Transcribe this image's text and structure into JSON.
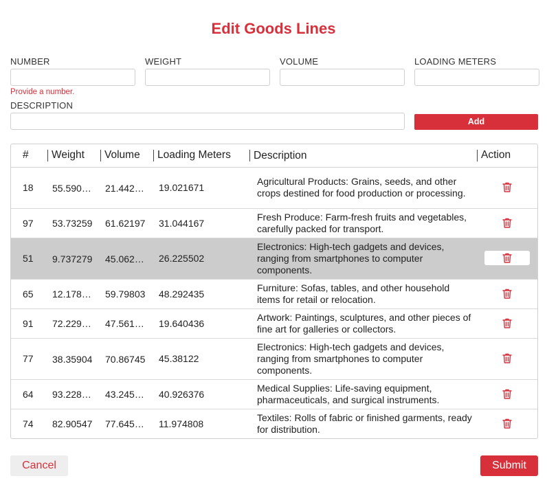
{
  "dialog": {
    "title": "Edit Goods Lines",
    "fields": {
      "number": {
        "label": "NUMBER",
        "value": ""
      },
      "weight": {
        "label": "WEIGHT",
        "value": ""
      },
      "volume": {
        "label": "VOLUME",
        "value": ""
      },
      "loading_meters": {
        "label": "LOADING METERS",
        "value": ""
      },
      "description": {
        "label": "DESCRIPTION",
        "value": ""
      }
    },
    "error_text": "Provide a number.",
    "add_label": "Add",
    "cancel_label": "Cancel",
    "submit_label": "Submit",
    "accent_color": "#d7303b"
  },
  "table": {
    "headers": {
      "num": "#",
      "weight": "Weight",
      "volume": "Volume",
      "loading_meters": "Loading Meters",
      "description": "Description",
      "action": "Action"
    },
    "selected_row": 2,
    "rows": [
      {
        "num": "18",
        "weight": "55.590…",
        "volume": "21.442…",
        "loading_meters": "19.021671",
        "description": "Agricultural Products: Grains, seeds, and other crops destined for food production or processing."
      },
      {
        "num": "97",
        "weight": "53.73259",
        "volume": "61.62197",
        "loading_meters": "31.044167",
        "description": "Fresh Produce: Farm-fresh fruits and vegetables, carefully packed for transport."
      },
      {
        "num": "51",
        "weight": "9.737279",
        "volume": "45.062…",
        "loading_meters": "26.225502",
        "description": "Electronics: High-tech gadgets and devices, ranging from smartphones to computer components."
      },
      {
        "num": "65",
        "weight": "12.178…",
        "volume": "59.79803",
        "loading_meters": "48.292435",
        "description": "Furniture: Sofas, tables, and other household items for retail or relocation."
      },
      {
        "num": "91",
        "weight": "72.229…",
        "volume": "47.561…",
        "loading_meters": "19.640436",
        "description": "Artwork: Paintings, sculptures, and other pieces of fine art for galleries or collectors."
      },
      {
        "num": "77",
        "weight": "38.35904",
        "volume": "70.86745",
        "loading_meters": "45.38122",
        "description": "Electronics: High-tech gadgets and devices, ranging from smartphones to computer components."
      },
      {
        "num": "64",
        "weight": "93.228…",
        "volume": "43.245…",
        "loading_meters": "40.926376",
        "description": "Medical Supplies: Life-saving equipment, pharmaceuticals, and surgical instruments."
      },
      {
        "num": "74",
        "weight": "82.90547",
        "volume": "77.645…",
        "loading_meters": "11.974808",
        "description": "Textiles: Rolls of fabric or finished garments, ready for distribution."
      }
    ],
    "action_icon": "trash-icon"
  }
}
